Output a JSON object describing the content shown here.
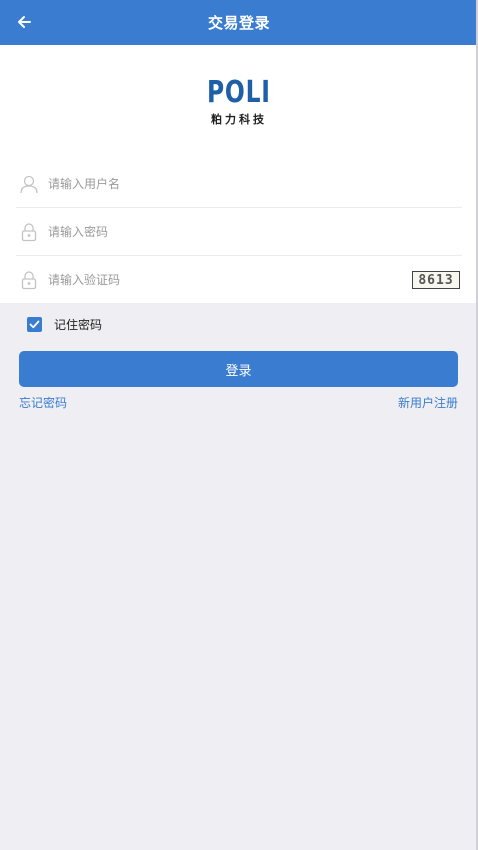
{
  "header": {
    "title": "交易登录",
    "back_icon": "arrow-left-icon"
  },
  "logo": {
    "brand": "POLI",
    "subtitle": "粕力科技"
  },
  "form": {
    "username_placeholder": "请输入用户名",
    "password_placeholder": "请输入密码",
    "captcha_placeholder": "请输入验证码",
    "captcha_code": "8613",
    "username_icon": "user-icon",
    "password_icon": "lock-icon",
    "captcha_icon": "lock-icon"
  },
  "remember": {
    "label": "记住密码",
    "checked": true
  },
  "actions": {
    "login_label": "登录",
    "forgot_label": "忘记密码",
    "register_label": "新用户注册"
  },
  "colors": {
    "primary": "#3a7cd0",
    "logo": "#1f5fa8",
    "background": "#eeeef3"
  }
}
